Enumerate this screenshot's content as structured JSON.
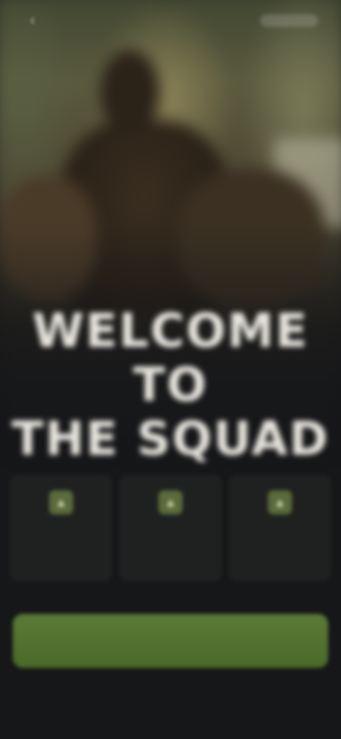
{
  "hero": {
    "title_line1": "WELCOME TO",
    "title_line2": "THE SQUAD"
  },
  "topbar": {
    "back_icon": "chevron-left-icon"
  },
  "colors": {
    "background": "#161719",
    "accent": "#4f6f2d",
    "headline": "#e9e6df"
  }
}
